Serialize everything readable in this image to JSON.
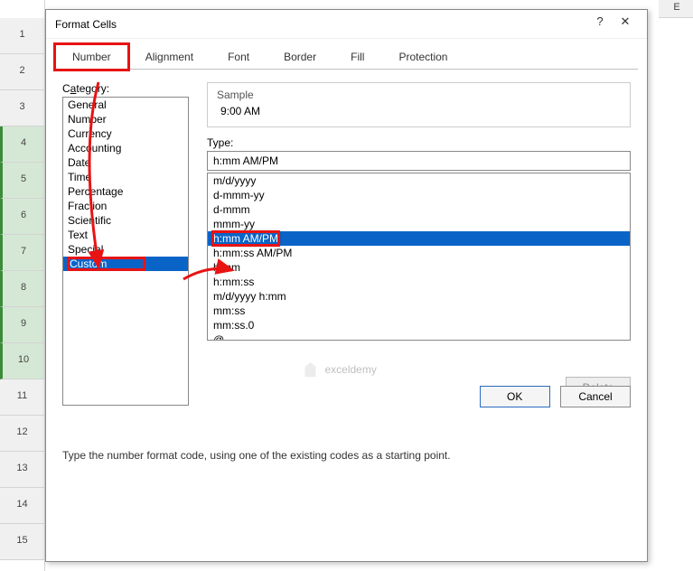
{
  "grid": {
    "col_header": "E",
    "rows": [
      "1",
      "2",
      "3",
      "4",
      "5",
      "6",
      "7",
      "8",
      "9",
      "10",
      "11",
      "12",
      "13",
      "14",
      "15"
    ]
  },
  "dialog": {
    "title": "Format Cells",
    "help": "?",
    "close": "✕"
  },
  "tabs": {
    "items": [
      "Number",
      "Alignment",
      "Font",
      "Border",
      "Fill",
      "Protection"
    ],
    "active_index": 0
  },
  "category": {
    "label_pre": "C",
    "label_u": "a",
    "label_post": "tegory:",
    "items": [
      "General",
      "Number",
      "Currency",
      "Accounting",
      "Date",
      "Time",
      "Percentage",
      "Fraction",
      "Scientific",
      "Text",
      "Special",
      "Custom"
    ],
    "selected_index": 11
  },
  "sample": {
    "label": "Sample",
    "value": "9:00 AM"
  },
  "type": {
    "label": "Type:",
    "input_value": "h:mm AM/PM",
    "items": [
      "m/d/yyyy",
      "d-mmm-yy",
      "d-mmm",
      "mmm-yy",
      "h:mm AM/PM",
      "h:mm:ss AM/PM",
      "h:mm",
      "h:mm:ss",
      "m/d/yyyy h:mm",
      "mm:ss",
      "mm:ss.0",
      "@"
    ],
    "selected_index": 4
  },
  "buttons": {
    "delete": "Delete",
    "ok": "OK",
    "cancel": "Cancel"
  },
  "hint": "Type the number format code, using one of the existing codes as a starting point.",
  "watermark": "exceldemy"
}
